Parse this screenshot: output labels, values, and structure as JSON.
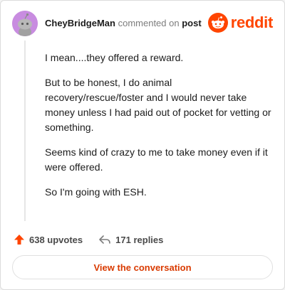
{
  "header": {
    "username": "CheyBridgeMan",
    "action_text": "commented on",
    "target_link": "post",
    "brand_name": "reddit"
  },
  "comment": {
    "paragraphs": [
      "I mean....they offered a reward.",
      "But to be honest, I do animal recovery/rescue/foster and I would never take money unless I had paid out of pocket for vetting or something.",
      "Seems kind of crazy to me to take money even if it were offered.",
      "So I'm going with ESH."
    ]
  },
  "stats": {
    "upvotes": "638 upvotes",
    "replies": "171 replies"
  },
  "cta": {
    "label": "View the conversation"
  },
  "colors": {
    "brand": "#ff4500",
    "cta_text": "#d93a00",
    "avatar_bg": "#c88ce0"
  },
  "icons": {
    "avatar": "default-snoo-avatar",
    "brand_logo": "reddit-snoo-logo",
    "upvote": "upvote-arrow-icon",
    "reply": "reply-arrow-icon"
  }
}
